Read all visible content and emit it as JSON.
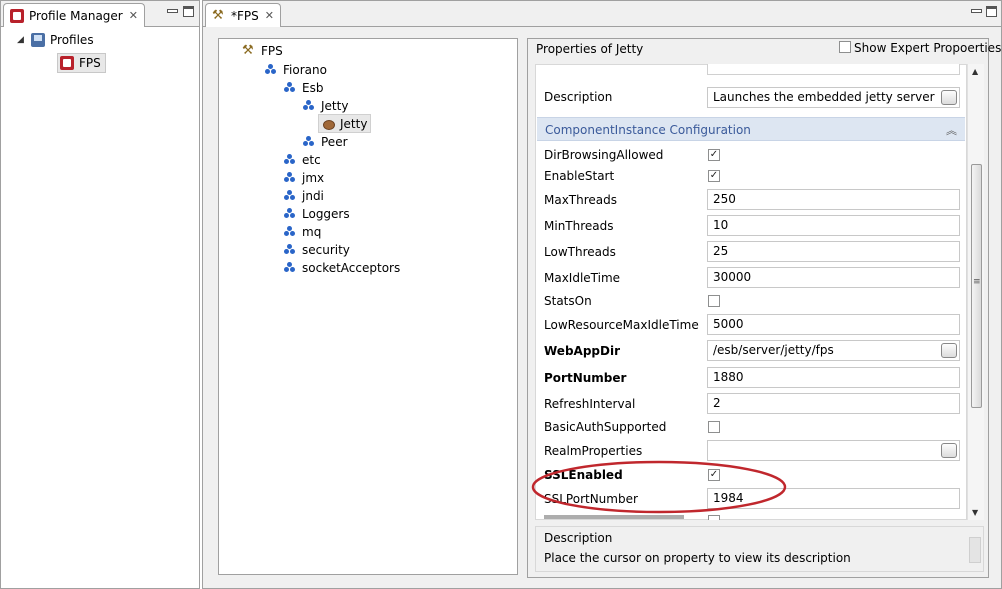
{
  "left_panel": {
    "tab_title": "Profile Manager",
    "tree": [
      {
        "label": "Profiles"
      },
      {
        "label": "FPS"
      }
    ]
  },
  "editor": {
    "tab_title": "*FPS",
    "tree": [
      {
        "label": "FPS"
      },
      {
        "label": "Fiorano"
      },
      {
        "label": "Esb"
      },
      {
        "label": "Jetty"
      },
      {
        "label": "Jetty"
      },
      {
        "label": "Peer"
      },
      {
        "label": "etc"
      },
      {
        "label": "jmx"
      },
      {
        "label": "jndi"
      },
      {
        "label": "Loggers"
      },
      {
        "label": "mq"
      },
      {
        "label": "security"
      },
      {
        "label": "socketAcceptors"
      }
    ]
  },
  "properties": {
    "title": "Properties of Jetty",
    "show_expert_label": "Show Expert Propoerties",
    "show_expert_checked": false,
    "description_row": {
      "label": "Description",
      "value": "Launches the embedded jetty server"
    },
    "section_title": "ComponentInstance Configuration",
    "rows": [
      {
        "label": "DirBrowsingAllowed",
        "type": "checkbox",
        "checked": true,
        "value": "✓"
      },
      {
        "label": "EnableStart",
        "type": "checkbox",
        "checked": true,
        "value": "✓"
      },
      {
        "label": "MaxThreads",
        "type": "text",
        "value": "250"
      },
      {
        "label": "MinThreads",
        "type": "text",
        "value": "10"
      },
      {
        "label": "LowThreads",
        "type": "text",
        "value": "25"
      },
      {
        "label": "MaxIdleTime",
        "type": "text",
        "value": "30000"
      },
      {
        "label": "StatsOn",
        "type": "checkbox",
        "checked": false,
        "value": ""
      },
      {
        "label": "LowResourceMaxIdleTime",
        "type": "text",
        "value": "5000"
      },
      {
        "label": "WebAppDir",
        "type": "text-button",
        "value": "/esb/server/jetty/fps"
      },
      {
        "label": "PortNumber",
        "type": "text",
        "value": "1880"
      },
      {
        "label": "RefreshInterval",
        "type": "text",
        "value": "2"
      },
      {
        "label": "BasicAuthSupported",
        "type": "checkbox",
        "checked": false,
        "value": ""
      },
      {
        "label": "RealmProperties",
        "type": "text-button",
        "value": ""
      },
      {
        "label": "SSLEnabled",
        "type": "checkbox",
        "checked": true,
        "value": "✓"
      },
      {
        "label": "SSLPortNumber",
        "type": "text",
        "value": "1984"
      }
    ],
    "description_panel": {
      "heading": "Description",
      "text": "Place the cursor on property to view its description"
    }
  },
  "colors": {
    "highlight_ellipse": "#c0272d",
    "section_header_bg": "#dde6f2",
    "section_header_text": "#3a5a9a"
  }
}
